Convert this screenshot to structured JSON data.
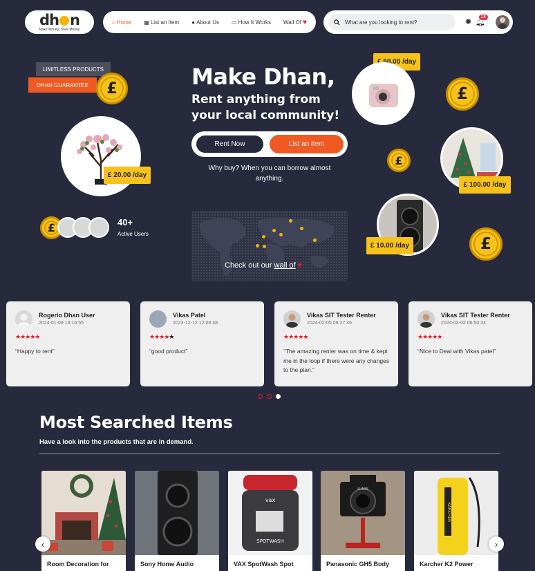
{
  "header": {
    "logo_text": "dhan",
    "logo_tagline": "Make Money, Save Money",
    "nav": [
      {
        "label": "Home",
        "icon": "home-icon"
      },
      {
        "label": "List an Item",
        "icon": "list-icon"
      },
      {
        "label": "About Us",
        "icon": "info-icon"
      },
      {
        "label": "How It Works",
        "icon": "chat-icon"
      },
      {
        "label": "Wall Of",
        "icon": "heart-icon"
      }
    ],
    "search_placeholder": "What are you looking to rent?",
    "notification_count": "18"
  },
  "hero": {
    "tag_limitless": "LIMITLESS PRODUCTS",
    "tag_guarantee": "DHAN GUARANTEE",
    "title": "Make Dhan,",
    "subtitle": "Rent anything from your local community!",
    "rent_now": "Rent Now",
    "list_item": "List an Item",
    "why_text": "Why buy? When you can borrow almost anything.",
    "map_text": "Check out our",
    "map_link": "wall of",
    "users_count": "40+",
    "users_label": "Active Users",
    "coin_symbol": "£",
    "prices": [
      "£ 50.00 /day",
      "£ 20.00 /day",
      "£ 100.00 /day",
      "£ 10.00 /day"
    ]
  },
  "reviews": [
    {
      "name": "Rogerio Dhan User",
      "date": "2024-01-09 19:16:55",
      "stars": "★★★★★",
      "text": "“Happy to rent”"
    },
    {
      "name": "Vikas Patel",
      "date": "2023-12-12 12:08:48",
      "stars": "★★★★★",
      "text": "“good product”"
    },
    {
      "name": "Vikas SIT Tester Renter",
      "date": "2024-02-05 06:27:46",
      "stars": "★★★★★",
      "text": "“The amazing renter was on time & kept me in the loop if there were any changes to the plan.”"
    },
    {
      "name": "Vikas SIT Tester Renter",
      "date": "2024-02-02 06:50:34",
      "stars": "★★★★★",
      "text": "“Nice to Deal with Vikas patel”"
    }
  ],
  "most_searched": {
    "title": "Most Searched Items",
    "subtitle": "Have a look into the products that are in demand.",
    "items": [
      {
        "label": "Room Decoration for"
      },
      {
        "label": "Sony Home Audio"
      },
      {
        "label": "VAX SpotWash Spot"
      },
      {
        "label": "Panasonic GH5 Body"
      },
      {
        "label": "Karcher K2 Power"
      }
    ],
    "vax_logo": "vax",
    "spotwash_logo": "SPOTWASH",
    "lumix_logo": "LUMIX",
    "karcher_logo": "KÄRCHER"
  },
  "colors": {
    "background": "#272a3c",
    "accent": "#f05a22",
    "gold": "#f7c21a"
  }
}
